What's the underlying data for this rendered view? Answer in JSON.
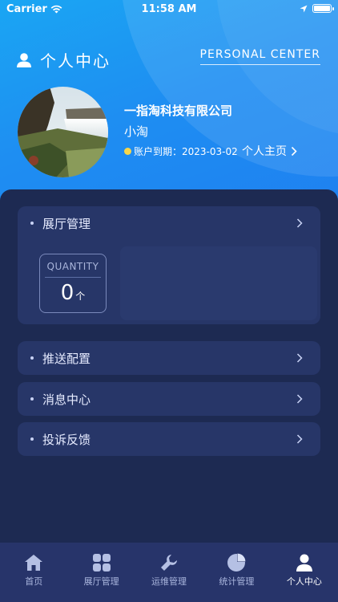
{
  "status_bar": {
    "carrier": "Carrier",
    "time": "11:58 AM"
  },
  "header": {
    "title": "个人中心",
    "subtitle_en": "PERSONAL CENTER"
  },
  "profile": {
    "company": "一指淘科技有限公司",
    "nickname": "小淘",
    "expiry_label": "账户到期：2023-03-02",
    "home_link": "个人主页"
  },
  "menu": {
    "exhibition": {
      "label": "展厅管理",
      "quantity_label": "QUANTITY",
      "quantity_value": "0",
      "quantity_unit": "个"
    },
    "push": {
      "label": "推送配置"
    },
    "messages": {
      "label": "消息中心"
    },
    "feedback": {
      "label": "投诉反馈"
    }
  },
  "tabbar": {
    "items": [
      {
        "label": "首页",
        "icon": "home-icon"
      },
      {
        "label": "展厅管理",
        "icon": "grid-icon"
      },
      {
        "label": "运维管理",
        "icon": "wrench-icon"
      },
      {
        "label": "统计管理",
        "icon": "pie-chart-icon"
      },
      {
        "label": "个人中心",
        "icon": "person-icon"
      }
    ],
    "active_index": 4
  },
  "colors": {
    "accent": "#1e8ef2",
    "panel": "#1d2a52",
    "card": "#273668"
  }
}
